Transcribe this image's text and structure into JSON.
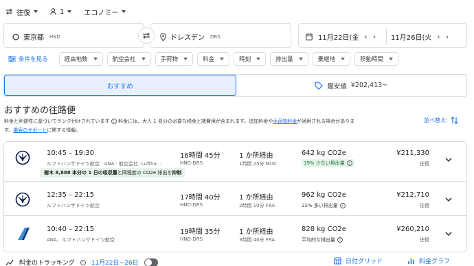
{
  "top": {
    "trip_type": "往復",
    "passengers": "1",
    "cabin": "エコノミー"
  },
  "search": {
    "from_city": "東京都",
    "from_code": "HND",
    "to_city": "ドレスデン",
    "to_code": "DRS",
    "depart_date": "11月22日(金",
    "return_date": "11月26日(火"
  },
  "filters": {
    "all_filters": "条件を見る",
    "chips": [
      "経由地数",
      "航空会社",
      "手荷物",
      "料金",
      "時刻",
      "排出量",
      "乗継地",
      "移動時間"
    ]
  },
  "tabs": {
    "recommended": "おすすめ",
    "cheapest": "最安値",
    "cheapest_price": "¥202,413~"
  },
  "results": {
    "heading": "おすすめの往路便",
    "note_line1a": "料金と利便性に基づいてランク付けされています",
    "note_line1b": "料金には、大人 1 名分の必要な税金と諸費用が含まれます。追加料金や",
    "note_link1": "手荷物料金",
    "note_line1c": "が適用される場合がありま",
    "note_line2a": "す。",
    "note_link2": "乗客のサポート",
    "note_line2b": "に関する情報。",
    "sort_label": "並べ替え:"
  },
  "flights": [
    {
      "times": "10:45 – 19:30",
      "airline": "ルフトハンザドイツ航空 · ANA · 航空会社: Luftha…",
      "duration": "16時間 45分",
      "route": "HND-DRS",
      "stops": "1 か所経由",
      "layover": "1時間 25分 MUC",
      "co2": "642 kg CO2e",
      "emission": "19% 少ない排出量",
      "price": "¥211,330",
      "trip": "往復",
      "eco_badge_bold1": "樹木 8,888 本分の 1 日の吸収量",
      "eco_badge_mid": "と同程度の CO2e 排出を",
      "eco_badge_bold2": "抑制"
    },
    {
      "times": "12:35 – 22:15",
      "airline": "ルフトハンザドイツ航空",
      "duration": "17時間 40分",
      "route": "HND-DRS",
      "stops": "1 か所経由",
      "layover": "2時間 10分 FRA",
      "co2": "962 kg CO2e",
      "emission": "22% 多い排出量",
      "price": "¥212,710",
      "trip": "往復"
    },
    {
      "times": "10:40 – 22:15",
      "airline": "ANA、ルフトハンザドイツ航空",
      "duration": "19時間 35分",
      "route": "HND-DRS",
      "stops": "1 か所経由",
      "layover": "3時間 40分 FRA",
      "co2": "828 kg CO2e",
      "emission": "平均的な排出量",
      "price": "¥260,210",
      "trip": "往復"
    }
  ],
  "bottom": {
    "tracking": "料金のトラッキング",
    "tracking_dates": "11月22日~26日",
    "date_grid": "日付グリッド",
    "price_graph": "料金グラフ"
  }
}
